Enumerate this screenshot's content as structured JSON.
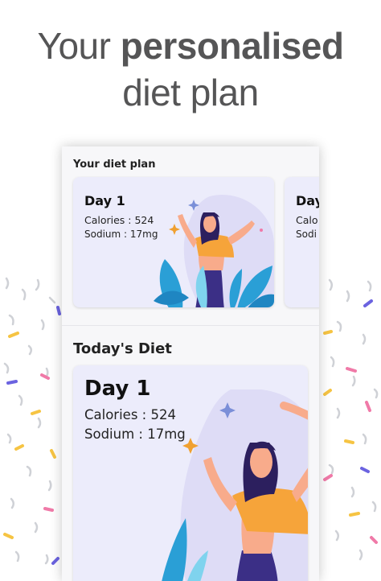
{
  "headline": {
    "line1_prefix": "Your ",
    "line1_bold": "personalised",
    "line2": "diet plan"
  },
  "diet_plan": {
    "section_title": "Your diet plan",
    "cards": [
      {
        "day": "Day 1",
        "calories": "Calories : 524",
        "sodium": "Sodium : 17mg"
      },
      {
        "day": "Day",
        "calories": "Calo",
        "sodium": "Sodi"
      }
    ]
  },
  "today": {
    "section_title": "Today's Diet",
    "card": {
      "day": "Day 1",
      "calories": "Calories : 524",
      "sodium": "Sodium : 17mg"
    }
  },
  "colors": {
    "card_bg": "#ececfb",
    "shirt": "#f6a43a",
    "pants": "#3b2f86",
    "hair": "#2c1f5e",
    "skin": "#f8ab8b",
    "leaves": "#2a9fd6",
    "sparkle": "#f0a030"
  }
}
